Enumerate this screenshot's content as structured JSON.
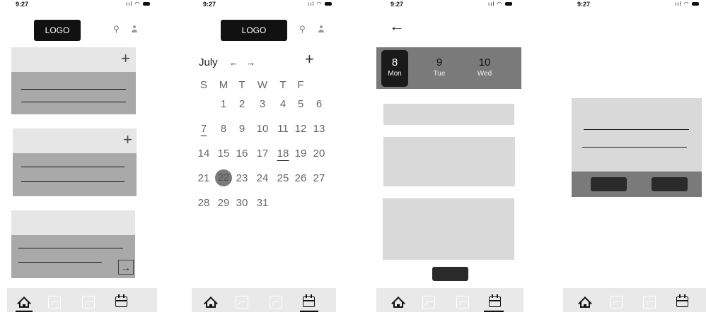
{
  "status": {
    "time": "9:27"
  },
  "header": {
    "logo": "LOGO"
  },
  "calendar": {
    "month": "July",
    "prev_arrow": "←",
    "next_arrow": "→",
    "add": "+",
    "weekdays": [
      "S",
      "M",
      "T",
      "W",
      "T",
      "F"
    ],
    "rows": [
      [
        "",
        "1",
        "2",
        "3",
        "4",
        "5",
        "6"
      ],
      [
        "7",
        "8",
        "9",
        "10",
        "11",
        "12",
        "13"
      ],
      [
        "14",
        "15",
        "16",
        "17",
        "18",
        "19",
        "20"
      ],
      [
        "21",
        "22",
        "23",
        "24",
        "25",
        "26",
        "27"
      ],
      [
        "28",
        "29",
        "30",
        "31",
        "",
        "",
        ""
      ]
    ],
    "underlined": [
      "7",
      "18"
    ],
    "selected": "22"
  },
  "day_picker": {
    "back": "←",
    "days": [
      {
        "num": "8",
        "weekday": "Mon",
        "active": true
      },
      {
        "num": "9",
        "weekday": "Tue",
        "active": false
      },
      {
        "num": "10",
        "weekday": "Wed",
        "active": false
      }
    ]
  },
  "icons": {
    "plus": "+",
    "arrow": "→",
    "search": "⚲"
  },
  "colors": {
    "dark": "#1a1a1a",
    "mid_gray": "#a9a9a9",
    "light_gray": "#e6e6e6",
    "strip_gray": "#7a7a7a"
  }
}
